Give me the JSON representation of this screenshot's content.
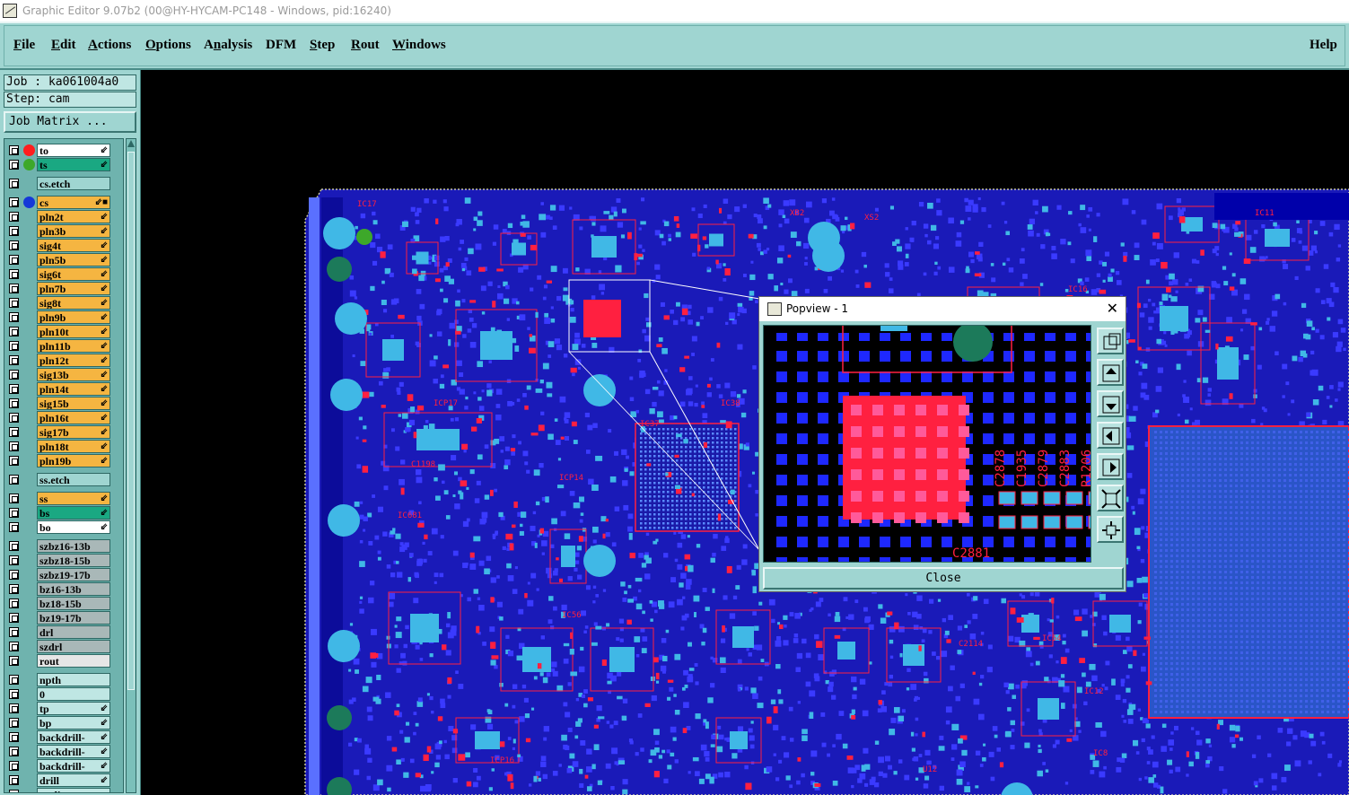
{
  "window": {
    "title": "Graphic Editor 9.07b2 (00@HY-HYCAM-PC148 - Windows, pid:16240)"
  },
  "menu": {
    "items": [
      {
        "label": "File",
        "mnemonic": "F"
      },
      {
        "label": "Edit",
        "mnemonic": "E"
      },
      {
        "label": "Actions",
        "mnemonic": "A"
      },
      {
        "label": "Options",
        "mnemonic": "O"
      },
      {
        "label": "Analysis",
        "mnemonic": "n"
      },
      {
        "label": "DFM",
        "mnemonic": ""
      },
      {
        "label": "Step",
        "mnemonic": "S"
      },
      {
        "label": "Rout",
        "mnemonic": "R"
      },
      {
        "label": "Windows",
        "mnemonic": "W"
      }
    ],
    "help": "Help"
  },
  "panel": {
    "job": "Job : ka061004a0",
    "step": "Step: cam",
    "job_matrix": "Job Matrix ..."
  },
  "layers": [
    {
      "name": "to",
      "bg": "#ffffff",
      "dot": "#ff1e1e",
      "edit": "⇙"
    },
    {
      "name": "ts",
      "bg": "#1aa882",
      "dot": "#3da82a",
      "edit": "⇙"
    },
    {
      "name": "cs.etch",
      "bg": "#9fd5d1",
      "dot": "",
      "edit": "",
      "gap": true
    },
    {
      "name": "cs",
      "bg": "#f5b541",
      "dot": "#1438d8",
      "edit": "⇙■",
      "gap": true
    },
    {
      "name": "pln2t",
      "bg": "#f5b541",
      "dot": "",
      "edit": "⇙"
    },
    {
      "name": "pln3b",
      "bg": "#f5b541",
      "dot": "",
      "edit": "⇙"
    },
    {
      "name": "sig4t",
      "bg": "#f5b541",
      "dot": "",
      "edit": "⇙"
    },
    {
      "name": "pln5b",
      "bg": "#f5b541",
      "dot": "",
      "edit": "⇙"
    },
    {
      "name": "sig6t",
      "bg": "#f5b541",
      "dot": "",
      "edit": "⇙"
    },
    {
      "name": "pln7b",
      "bg": "#f5b541",
      "dot": "",
      "edit": "⇙"
    },
    {
      "name": "sig8t",
      "bg": "#f5b541",
      "dot": "",
      "edit": "⇙"
    },
    {
      "name": "pln9b",
      "bg": "#f5b541",
      "dot": "",
      "edit": "⇙"
    },
    {
      "name": "pln10t",
      "bg": "#f5b541",
      "dot": "",
      "edit": "⇙"
    },
    {
      "name": "pln11b",
      "bg": "#f5b541",
      "dot": "",
      "edit": "⇙"
    },
    {
      "name": "pln12t",
      "bg": "#f5b541",
      "dot": "",
      "edit": "⇙"
    },
    {
      "name": "sig13b",
      "bg": "#f5b541",
      "dot": "",
      "edit": "⇙"
    },
    {
      "name": "pln14t",
      "bg": "#f5b541",
      "dot": "",
      "edit": "⇙"
    },
    {
      "name": "sig15b",
      "bg": "#f5b541",
      "dot": "",
      "edit": "⇙"
    },
    {
      "name": "pln16t",
      "bg": "#f5b541",
      "dot": "",
      "edit": "⇙"
    },
    {
      "name": "sig17b",
      "bg": "#f5b541",
      "dot": "",
      "edit": "⇙"
    },
    {
      "name": "pln18t",
      "bg": "#f5b541",
      "dot": "",
      "edit": "⇙"
    },
    {
      "name": "pln19b",
      "bg": "#f5b541",
      "dot": "",
      "edit": "⇙"
    },
    {
      "name": "ss.etch",
      "bg": "#9fd5d1",
      "dot": "",
      "edit": "",
      "gap": true
    },
    {
      "name": "ss",
      "bg": "#f5b541",
      "dot": "",
      "edit": "⇙",
      "gap": true
    },
    {
      "name": "bs",
      "bg": "#1aa882",
      "dot": "",
      "edit": "⇙"
    },
    {
      "name": "bo",
      "bg": "#ffffff",
      "dot": "",
      "edit": "⇙"
    },
    {
      "name": "szbz16-13b",
      "bg": "#a9b8b8",
      "dot": "",
      "edit": "",
      "gap": true
    },
    {
      "name": "szbz18-15b",
      "bg": "#a9b8b8",
      "dot": "",
      "edit": ""
    },
    {
      "name": "szbz19-17b",
      "bg": "#a9b8b8",
      "dot": "",
      "edit": ""
    },
    {
      "name": "bz16-13b",
      "bg": "#a9b8b8",
      "dot": "",
      "edit": ""
    },
    {
      "name": "bz18-15b",
      "bg": "#a9b8b8",
      "dot": "",
      "edit": ""
    },
    {
      "name": "bz19-17b",
      "bg": "#a9b8b8",
      "dot": "",
      "edit": ""
    },
    {
      "name": "drl",
      "bg": "#a9b8b8",
      "dot": "",
      "edit": ""
    },
    {
      "name": "szdrl",
      "bg": "#a9b8b8",
      "dot": "",
      "edit": ""
    },
    {
      "name": "rout",
      "bg": "#e6e6e6",
      "dot": "",
      "edit": ""
    },
    {
      "name": "npth",
      "bg": "#bfe6e3",
      "dot": "",
      "edit": "",
      "gap": true
    },
    {
      "name": "0",
      "bg": "#bfe6e3",
      "dot": "",
      "edit": ""
    },
    {
      "name": "tp",
      "bg": "#bfe6e3",
      "dot": "",
      "edit": "⇙"
    },
    {
      "name": "bp",
      "bg": "#bfe6e3",
      "dot": "",
      "edit": "⇙"
    },
    {
      "name": "backdrill-",
      "bg": "#bfe6e3",
      "dot": "",
      "edit": "⇙"
    },
    {
      "name": "backdrill-",
      "bg": "#bfe6e3",
      "dot": "",
      "edit": "⇙"
    },
    {
      "name": "backdrill-",
      "bg": "#bfe6e3",
      "dot": "",
      "edit": "⇙"
    },
    {
      "name": "drill",
      "bg": "#bfe6e3",
      "dot": "",
      "edit": "⇙"
    },
    {
      "name": "outline",
      "bg": "#bfe6e3",
      "dot": "",
      "edit": ""
    }
  ],
  "board_labels": [
    "IC17",
    "ICP17",
    "IC681",
    "IC56",
    "IC38",
    "IC37",
    "ICP16",
    "ICP14",
    "IC54",
    "IC16",
    "IC12",
    "C1198",
    "XB2",
    "XS2",
    "IC11",
    "C2114",
    "IC8",
    "U12"
  ],
  "popview": {
    "title": "Popview - 1",
    "close_label": "Close",
    "labels": [
      "C2878",
      "C1935",
      "C2879",
      "C2883",
      "R1206",
      "C2881"
    ],
    "tools": [
      "zoom-home-icon",
      "pan-up-icon",
      "pan-down-icon",
      "pan-left-icon",
      "pan-right-icon",
      "zoom-in-icon",
      "zoom-out-icon"
    ]
  },
  "colors": {
    "board_blue": "#1e1ecf",
    "pad_cyan": "#40b8e6",
    "trace_red": "#ff2040",
    "ui_teal": "#9fd5d1"
  }
}
